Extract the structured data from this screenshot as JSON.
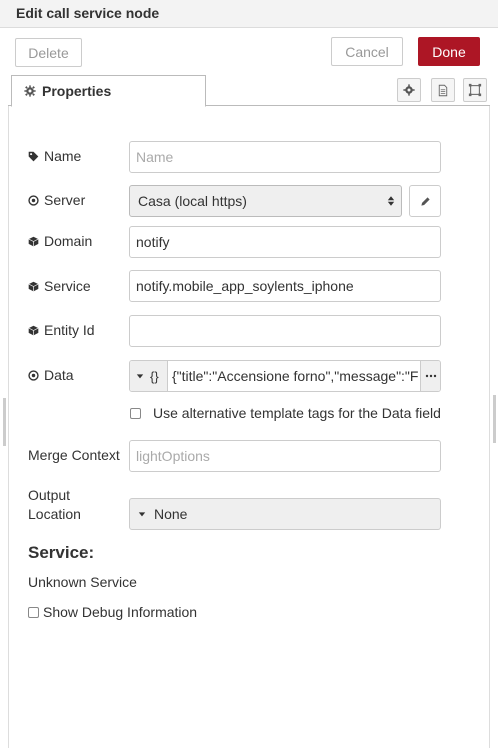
{
  "header": {
    "title": "Edit call service node"
  },
  "toolbar": {
    "delete_label": "Delete",
    "cancel_label": "Cancel",
    "done_label": "Done",
    "done_color": "#ad1625"
  },
  "tabs": [
    {
      "label": "Properties",
      "icon": "gear-icon"
    }
  ],
  "tab_icons": [
    "gear-icon",
    "description-icon",
    "appearance-icon"
  ],
  "form": {
    "name": {
      "label": "Name",
      "placeholder": "Name",
      "value": "",
      "icon": "tag-icon"
    },
    "server": {
      "label": "Server",
      "selected": "Casa (local https)",
      "icon": "dot-circle-icon"
    },
    "domain": {
      "label": "Domain",
      "value": "notify",
      "icon": "cube-icon"
    },
    "service": {
      "label": "Service",
      "value": "notify.mobile_app_soylents_iphone",
      "icon": "cube-icon"
    },
    "entity_id": {
      "label": "Entity Id",
      "value": "",
      "icon": "cube-icon"
    },
    "data": {
      "label": "Data",
      "type_symbol": "{}",
      "value": "{\"title\":\"Accensione forno\",\"message\":\"F",
      "icon": "dot-circle-icon"
    },
    "alt_template": {
      "label": "Use alternative template tags for the Data field",
      "checked": false
    },
    "merge_context": {
      "label": "Merge Context",
      "placeholder": "lightOptions",
      "value": ""
    },
    "output_location": {
      "label_line1": "Output",
      "label_line2": "Location",
      "selected": "None"
    }
  },
  "service_info": {
    "heading": "Service:",
    "text": "Unknown Service"
  },
  "debug": {
    "label": "Show Debug Information",
    "checked": false
  }
}
